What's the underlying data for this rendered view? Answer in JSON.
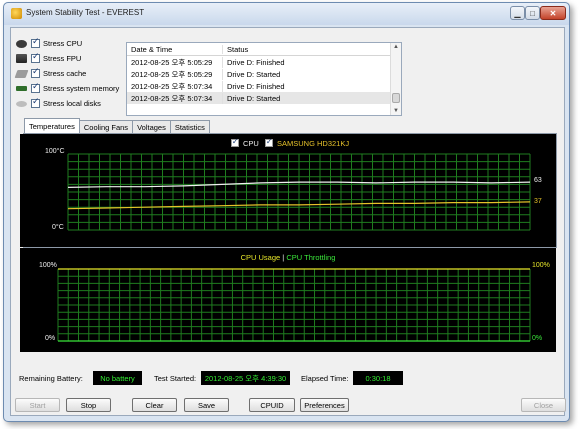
{
  "window": {
    "title": "System Stability Test - EVEREST"
  },
  "stress_options": [
    {
      "label": "Stress CPU",
      "icon": "cpu-icon",
      "checked": true
    },
    {
      "label": "Stress FPU",
      "icon": "fpu-icon",
      "checked": true
    },
    {
      "label": "Stress cache",
      "icon": "cache-icon",
      "checked": true
    },
    {
      "label": "Stress system memory",
      "icon": "memory-icon",
      "checked": true
    },
    {
      "label": "Stress local disks",
      "icon": "disk-icon",
      "checked": true
    }
  ],
  "log": {
    "columns": [
      "Date & Time",
      "Status"
    ],
    "rows": [
      {
        "time": "2012-08-25 오후 5:05:29",
        "status": "Drive D: Finished"
      },
      {
        "time": "2012-08-25 오후 5:05:29",
        "status": "Drive D: Started"
      },
      {
        "time": "2012-08-25 오후 5:07:34",
        "status": "Drive D: Finished"
      },
      {
        "time": "2012-08-25 오후 5:07:34",
        "status": "Drive D: Started"
      }
    ]
  },
  "tabs": [
    {
      "label": "Temperatures",
      "active": true
    },
    {
      "label": "Cooling Fans",
      "active": false
    },
    {
      "label": "Voltages",
      "active": false
    },
    {
      "label": "Statistics",
      "active": false
    }
  ],
  "temperature_chart": {
    "legend": [
      {
        "label": "CPU",
        "color": "#f0f0f0"
      },
      {
        "label": "SAMSUNG HD321KJ",
        "color": "#e6c22a"
      }
    ],
    "y_top_label": "100°C",
    "y_bottom_label": "0°C",
    "end_value_labels": [
      "63",
      "37"
    ]
  },
  "cpu_chart": {
    "legend_usage": "CPU Usage",
    "legend_sep": "|",
    "legend_throttling": "CPU Throttling",
    "left_top": "100%",
    "left_bottom": "0%",
    "right_top": "100%",
    "right_bottom": "0%"
  },
  "chart_data": [
    {
      "type": "line",
      "ylabel": "°C",
      "ylim": [
        0,
        100
      ],
      "grid": true,
      "legend_placement": "top-center",
      "x": [
        0,
        1,
        2,
        3,
        4,
        5,
        6,
        7,
        8,
        9,
        10,
        11,
        12
      ],
      "series": [
        {
          "name": "CPU",
          "color": "#f0f0f0",
          "values": [
            56,
            57,
            57,
            58,
            60,
            62,
            63,
            63,
            62,
            63,
            63,
            62,
            63
          ]
        },
        {
          "name": "SAMSUNG HD321KJ",
          "color": "#e6c22a",
          "values": [
            28,
            29,
            30,
            31,
            32,
            33,
            33,
            34,
            35,
            35,
            36,
            36,
            37
          ]
        }
      ],
      "end_labels": [
        "63",
        "37"
      ]
    },
    {
      "type": "line",
      "ylim": [
        0,
        100
      ],
      "grid": true,
      "legend_placement": "top-center",
      "series": [
        {
          "name": "CPU Usage",
          "color": "#e6e62a",
          "values": [
            100,
            100
          ]
        },
        {
          "name": "CPU Throttling",
          "color": "#3ae63a",
          "values": [
            0,
            0
          ]
        }
      ]
    }
  ],
  "status": {
    "battery_label": "Remaining Battery:",
    "battery_value": "No battery",
    "started_label": "Test Started:",
    "started_value": "2012-08-25 오후 4:39:30",
    "elapsed_label": "Elapsed Time:",
    "elapsed_value": "0:30:18"
  },
  "buttons": {
    "start": "Start",
    "stop": "Stop",
    "clear": "Clear",
    "save": "Save",
    "cpuid": "CPUID",
    "preferences": "Preferences",
    "close": "Close"
  }
}
